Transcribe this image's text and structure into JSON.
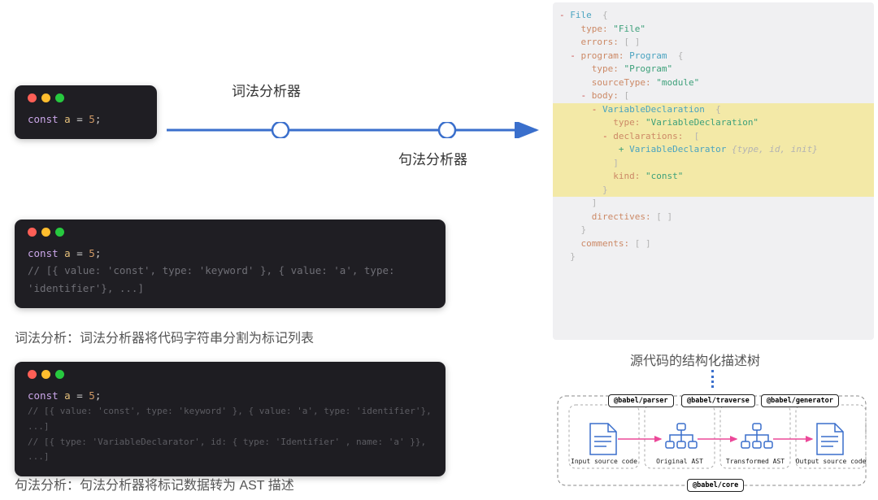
{
  "topbar": {
    "lexer_label": "词法分析器",
    "parser_label": "句法分析器"
  },
  "code_windows": {
    "snippet1": {
      "keyword": "const",
      "variable": "a",
      "op": "=",
      "value": "5",
      "semi": ";"
    },
    "snippet2": {
      "code_line": "const a = 5;",
      "comment": "// [{ value: 'const', type: 'keyword' }, { value: 'a', type: 'identifier'}, ...]"
    },
    "snippet3": {
      "code_line": "const a = 5;",
      "comment1": "// [{ value: 'const', type: 'keyword' }, { value: 'a', type: 'identifier'}, ...]",
      "comment2": "// [{ type: 'VariableDeclarator', id: { type: 'Identifier' , name: 'a' }}, ...]"
    }
  },
  "captions": {
    "lexer": "词法分析：词法分析器将代码字符串分割为标记列表",
    "parser": "句法分析：句法分析器将标记数据转为 AST 描述",
    "ast": "源代码的结构化描述树"
  },
  "ast": {
    "root": "File",
    "file_type": "\"File\"",
    "errors": "[ ]",
    "program": "Program",
    "program_type": "\"Program\"",
    "sourceType": "\"module\"",
    "body_label": "body:",
    "vd": "VariableDeclaration",
    "vd_type": "\"VariableDeclaration\"",
    "decl_label": "declarations:",
    "decl_item": "VariableDeclarator",
    "decl_fields": "{type, id, init}",
    "kind_val": "\"const\"",
    "directives": "[ ]",
    "comments": "[ ]",
    "k_type": "type:",
    "k_errors": "errors:",
    "k_program": "program:",
    "k_source": "sourceType:",
    "k_kind": "kind:",
    "k_dir": "directives:",
    "k_com": "comments:"
  },
  "pipeline": {
    "steps": [
      "Input source code",
      "Original AST",
      "Transformed AST",
      "Output source code"
    ],
    "boxes": [
      "@babel/parser",
      "@babel/traverse",
      "@babel/generator"
    ],
    "core": "@babel/core"
  }
}
